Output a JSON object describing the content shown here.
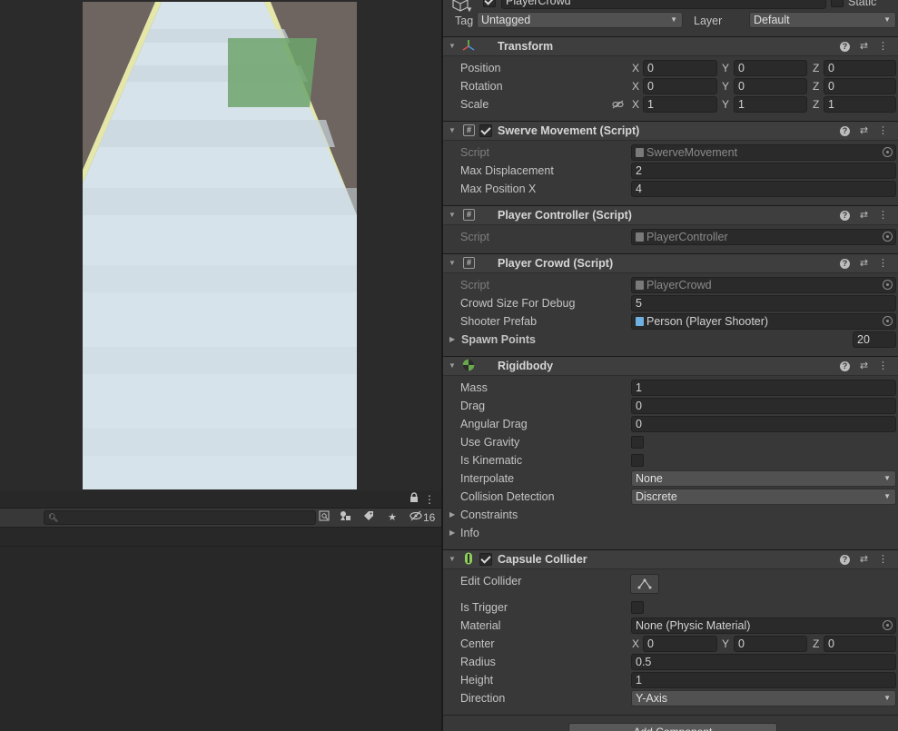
{
  "gameobject": {
    "name": "PlayerCrowd",
    "static_label": "Static",
    "tag_label": "Tag",
    "tag_value": "Untagged",
    "layer_label": "Layer",
    "layer_value": "Default"
  },
  "transform": {
    "title": "Transform",
    "position": {
      "label": "Position",
      "x": "0",
      "y": "0",
      "z": "0"
    },
    "rotation": {
      "label": "Rotation",
      "x": "0",
      "y": "0",
      "z": "0"
    },
    "scale": {
      "label": "Scale",
      "x": "1",
      "y": "1",
      "z": "1"
    },
    "axes": {
      "x": "X",
      "y": "Y",
      "z": "Z"
    }
  },
  "swerve": {
    "title": "Swerve Movement (Script)",
    "script_label": "Script",
    "script_value": "SwerveMovement",
    "max_disp_label": "Max Displacement",
    "max_disp_value": "2",
    "max_pos_label": "Max Position X",
    "max_pos_value": "4"
  },
  "player_controller": {
    "title": "Player Controller (Script)",
    "script_label": "Script",
    "script_value": "PlayerController"
  },
  "player_crowd": {
    "title": "Player Crowd (Script)",
    "script_label": "Script",
    "script_value": "PlayerCrowd",
    "crowd_label": "Crowd Size For Debug",
    "crowd_value": "5",
    "shooter_label": "Shooter Prefab",
    "shooter_value": "Person (Player Shooter)",
    "spawn_label": "Spawn Points",
    "spawn_value": "20"
  },
  "rigidbody": {
    "title": "Rigidbody",
    "mass_label": "Mass",
    "mass_value": "1",
    "drag_label": "Drag",
    "drag_value": "0",
    "angular_label": "Angular Drag",
    "angular_value": "0",
    "gravity_label": "Use Gravity",
    "kinematic_label": "Is Kinematic",
    "interpolate_label": "Interpolate",
    "interpolate_value": "None",
    "collision_label": "Collision Detection",
    "collision_value": "Discrete",
    "constraints_label": "Constraints",
    "info_label": "Info"
  },
  "capsule": {
    "title": "Capsule Collider",
    "edit_label": "Edit Collider",
    "trigger_label": "Is Trigger",
    "material_label": "Material",
    "material_value": "None (Physic Material)",
    "center_label": "Center",
    "center_x": "0",
    "center_y": "0",
    "center_z": "0",
    "radius_label": "Radius",
    "radius_value": "0.5",
    "height_label": "Height",
    "height_value": "1",
    "direction_label": "Direction",
    "direction_value": "Y-Axis"
  },
  "add_component_label": "Add Component",
  "bottom": {
    "search_placeholder": "",
    "hidden_count": "16"
  },
  "colors": {
    "inspector_bg": "#383838",
    "header_bg": "#3e3e3e",
    "field_bg": "#2a2a2a",
    "road": "#d7e3ea",
    "rail": "#e4e7a8",
    "ground": "#6e6460",
    "green_box": "#6fa46c"
  }
}
